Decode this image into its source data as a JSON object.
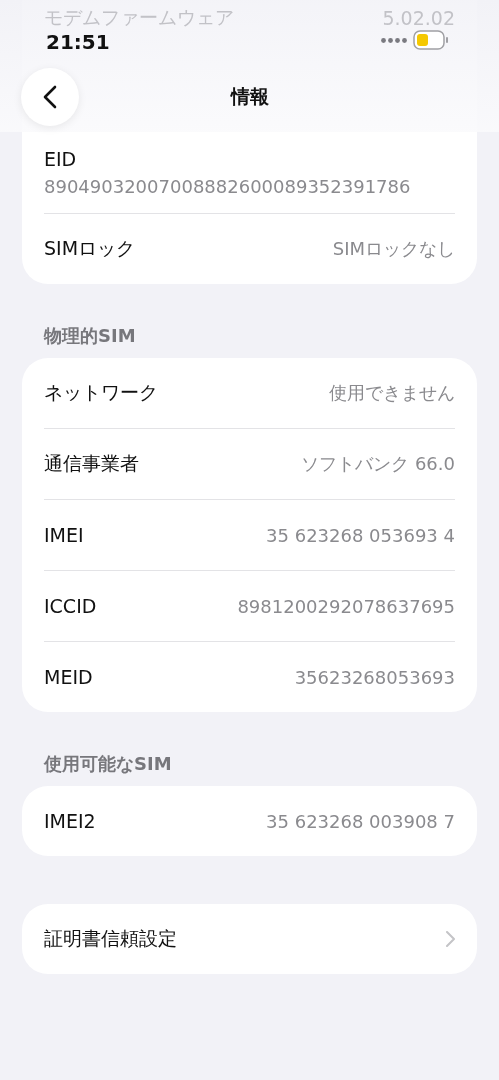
{
  "status_bar": {
    "time": "21:51"
  },
  "scrolled_under": {
    "label": "モデムファームウェア",
    "value": "5.02.02"
  },
  "nav": {
    "title": "情報"
  },
  "top_card": {
    "eid": {
      "label": "EID",
      "value": "89049032007008882600089352391786"
    },
    "rows": [
      {
        "label": "SIMロック",
        "value": "SIMロックなし"
      }
    ]
  },
  "sections": [
    {
      "header": "物理的SIM",
      "rows": [
        {
          "label": "ネットワーク",
          "value": "使用できません"
        },
        {
          "label": "通信事業者",
          "value": "ソフトバンク 66.0"
        },
        {
          "label": "IMEI",
          "value": "35 623268 053693 4"
        },
        {
          "label": "ICCID",
          "value": "8981200292078637695"
        },
        {
          "label": "MEID",
          "value": "35623268053693"
        }
      ]
    },
    {
      "header": "使用可能なSIM",
      "rows": [
        {
          "label": "IMEI2",
          "value": "35 623268 003908 7"
        }
      ]
    }
  ],
  "link_row": {
    "label": "証明書信頼設定"
  }
}
